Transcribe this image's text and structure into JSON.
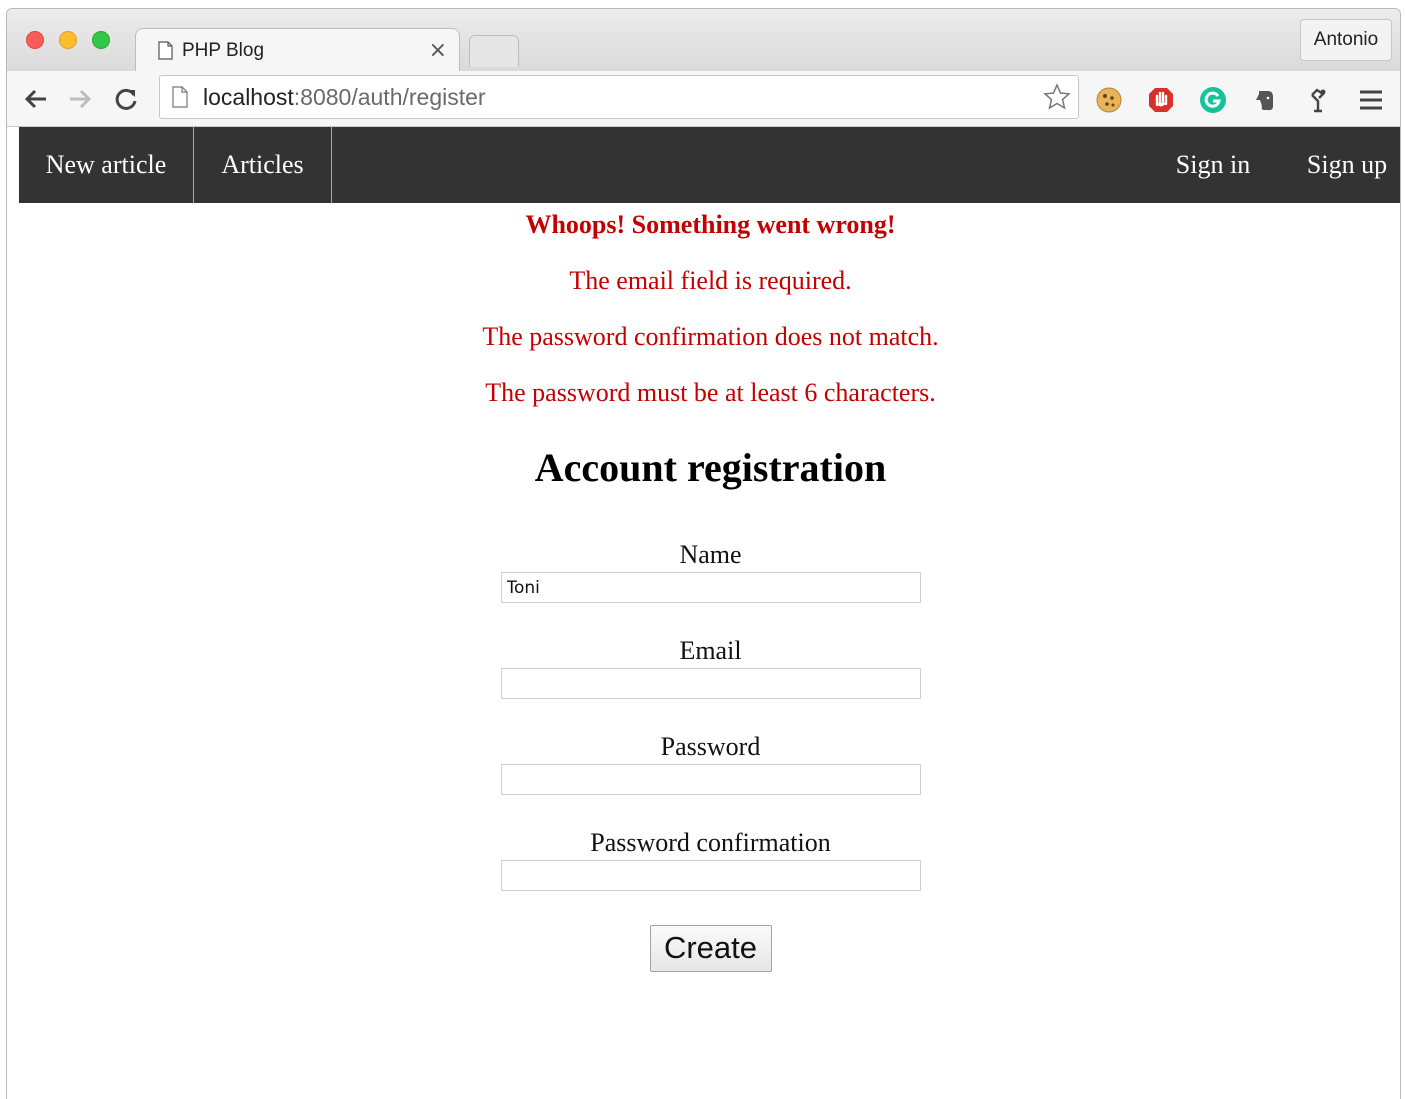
{
  "browser": {
    "tab_title": "PHP Blog",
    "tab_close": "×",
    "profile_name": "Antonio",
    "url_host": "localhost",
    "url_rest": ":8080/auth/register",
    "icons": {
      "back": "back-arrow-icon",
      "forward": "forward-arrow-icon",
      "reload": "reload-icon",
      "bookmark": "star-icon",
      "menu": "hamburger-menu-icon"
    }
  },
  "navbar": {
    "new_article": "New article",
    "articles": "Articles",
    "sign_in": "Sign in",
    "sign_up": "Sign up"
  },
  "errors": {
    "title": "Whoops! Something went wrong!",
    "messages": [
      "The email field is required.",
      "The password confirmation does not match.",
      "The password must be at least 6 characters."
    ]
  },
  "form": {
    "title": "Account registration",
    "fields": {
      "name": {
        "label": "Name",
        "value": "Toni"
      },
      "email": {
        "label": "Email",
        "value": ""
      },
      "password": {
        "label": "Password",
        "value": ""
      },
      "password_confirmation": {
        "label": "Password confirmation",
        "value": ""
      }
    },
    "submit_label": "Create"
  },
  "colors": {
    "navbar_bg": "#333333",
    "error_red": "#c40000"
  }
}
